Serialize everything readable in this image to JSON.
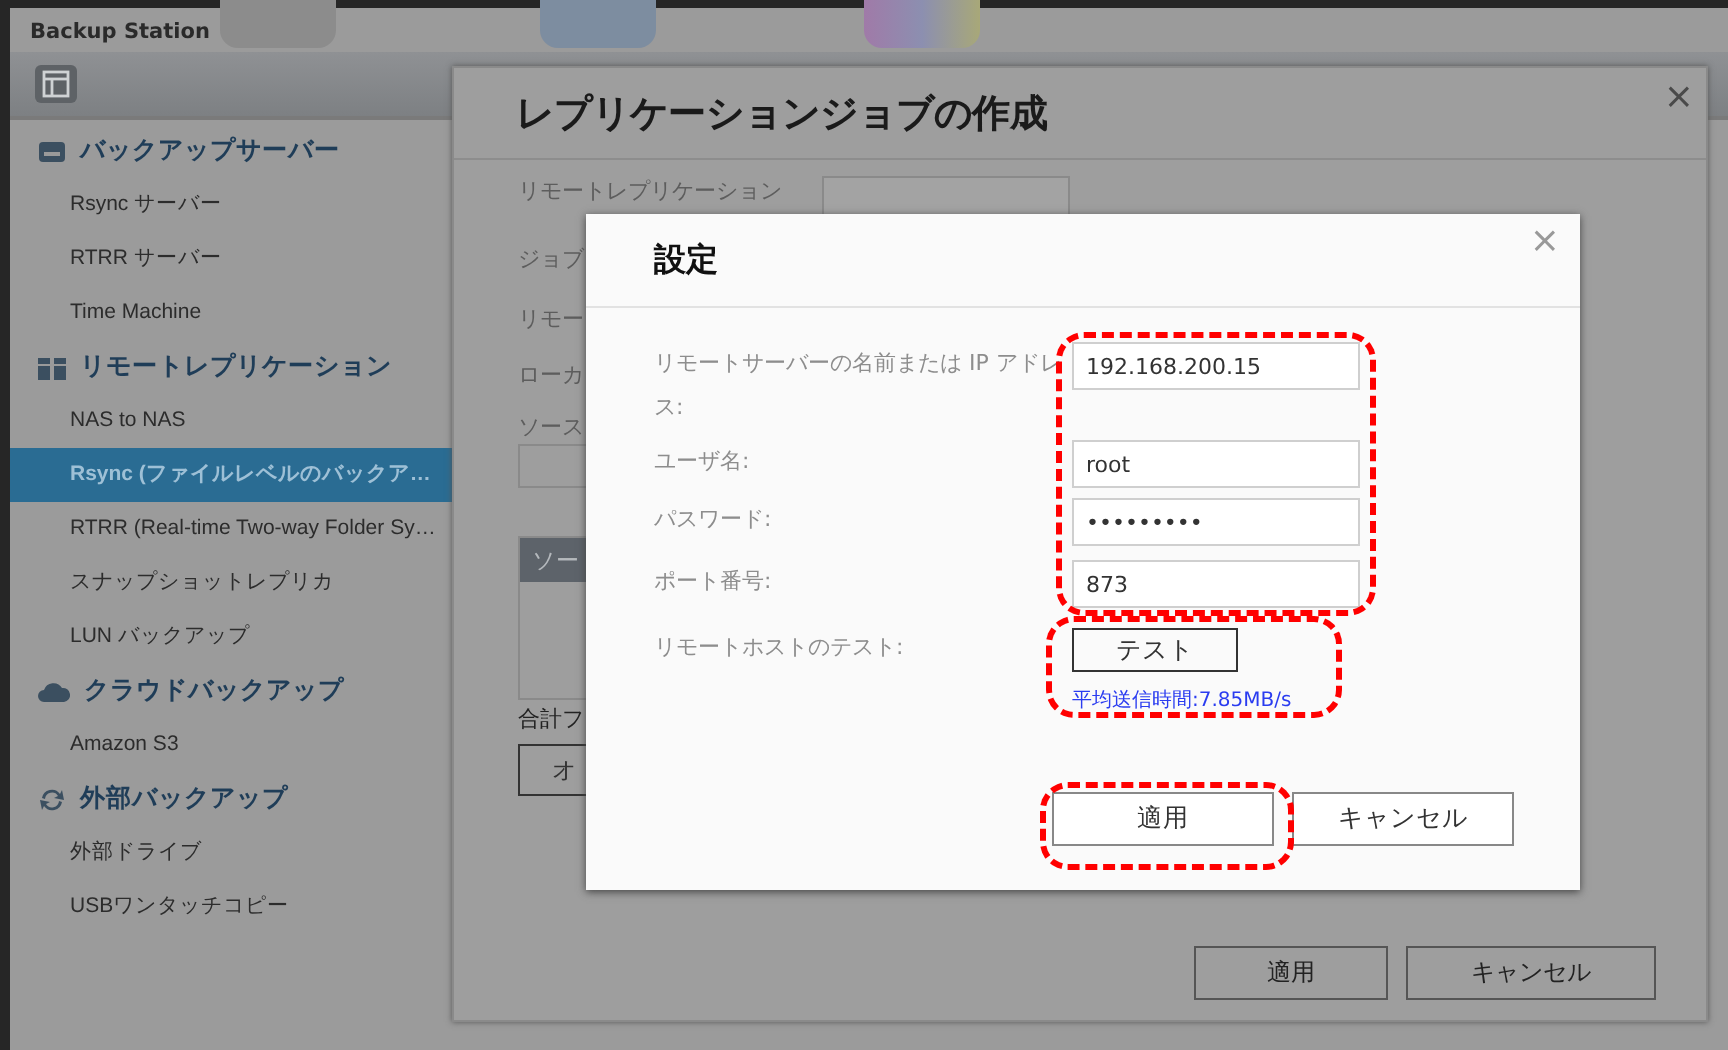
{
  "window": {
    "title": "Backup Station"
  },
  "sidebar": {
    "sections": [
      {
        "title": "バックアップサーバー",
        "items": [
          {
            "label": "Rsync サーバー",
            "selected": false
          },
          {
            "label": "RTRR サーバー",
            "selected": false
          },
          {
            "label": "Time Machine",
            "selected": false
          }
        ]
      },
      {
        "title": "リモートレプリケーション",
        "items": [
          {
            "label": "NAS to NAS",
            "selected": false
          },
          {
            "label": "Rsync (ファイルレベルのバックア…",
            "selected": true
          },
          {
            "label": "RTRR (Real-time Two-way Folder Sy…",
            "selected": false
          },
          {
            "label": "スナップショットレプリカ",
            "selected": false
          },
          {
            "label": "LUN バックアップ",
            "selected": false
          }
        ]
      },
      {
        "title": "クラウドバックアップ",
        "items": [
          {
            "label": "Amazon S3",
            "selected": false
          }
        ]
      },
      {
        "title": "外部バックアップ",
        "items": [
          {
            "label": "外部ドライブ",
            "selected": false
          },
          {
            "label": "USBワンタッチコピー",
            "selected": false
          }
        ]
      }
    ]
  },
  "job_dialog": {
    "title": "レプリケーションジョブの作成",
    "close": "×",
    "labels": [
      "リモートレプリケーション",
      "ジョブ",
      "リモー",
      "ローカ",
      "ソース"
    ],
    "table_header": "ソー",
    "total_label": "合計フ",
    "option_button": "オ",
    "buttons": [
      "適用",
      "キャンセル"
    ]
  },
  "settings_dialog": {
    "title": "設定",
    "close": "×",
    "fields_highlighted": true,
    "fields": [
      {
        "label": "リモートサーバーの名前または IP アドレス:",
        "value": "192.168.200.15"
      },
      {
        "label": "ユーザ名:",
        "value": "root"
      },
      {
        "label": "パスワード:",
        "value": "•••••••••"
      },
      {
        "label": "ポート番号:",
        "value": "873"
      }
    ],
    "test": {
      "label": "リモートホストのテスト:",
      "button": "テスト",
      "result": "平均送信時間:7.85MB/s",
      "highlighted": true
    },
    "buttons": [
      {
        "label": "適用",
        "highlighted": true
      },
      {
        "label": "キャンセル",
        "highlighted": false
      }
    ]
  }
}
